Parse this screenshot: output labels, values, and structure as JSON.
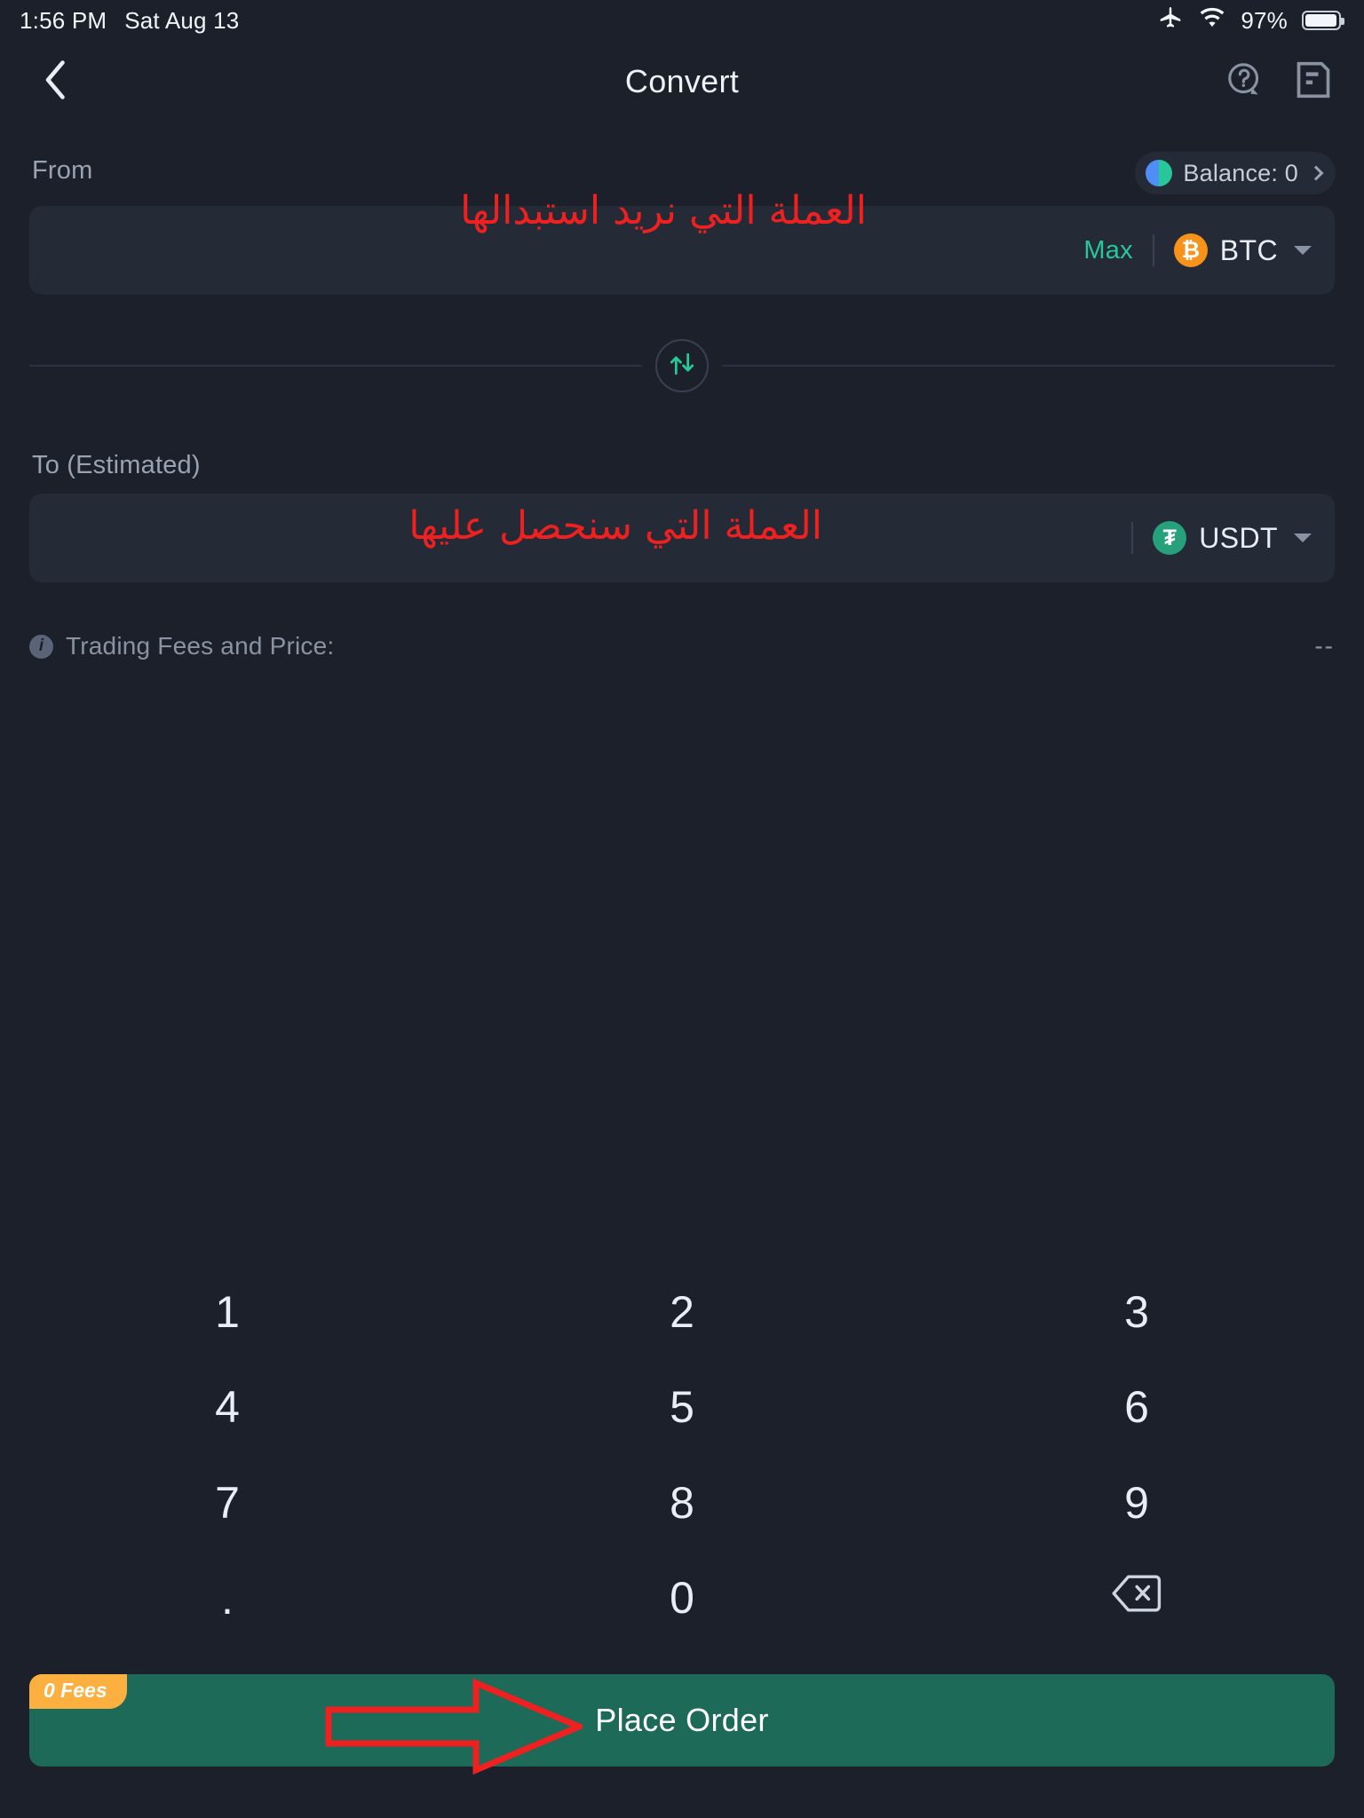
{
  "status_bar": {
    "time": "1:56 PM",
    "date": "Sat Aug 13",
    "battery_percent": "97%",
    "icons": [
      "airplane-icon",
      "wifi-icon",
      "battery-icon"
    ]
  },
  "header": {
    "title": "Convert",
    "back_icon": "chevron-left-icon",
    "help_icon": "help-circle-icon",
    "orders_icon": "order-history-icon"
  },
  "from_section": {
    "label": "From",
    "balance_label": "Balance: 0",
    "amount_value": "",
    "amount_placeholder": "",
    "max_label": "Max",
    "coin_symbol": "BTC",
    "coin_glyph": "₿",
    "coin_color": "#f7931a",
    "annotation": "العملة التي نريد استبدالها"
  },
  "swap": {
    "icon": "swap-vertical-icon",
    "color": "#27c79a"
  },
  "to_section": {
    "label": "To (Estimated)",
    "amount_value": "",
    "amount_placeholder": "",
    "coin_symbol": "USDT",
    "coin_glyph": "₮",
    "coin_color": "#26a17b",
    "annotation": "العملة التي سنحصل عليها"
  },
  "fees_row": {
    "info_icon": "info-icon",
    "label": "Trading Fees and Price:",
    "value": "--"
  },
  "keypad": {
    "keys": [
      "1",
      "2",
      "3",
      "4",
      "5",
      "6",
      "7",
      "8",
      "9",
      ".",
      "0",
      "backspace-icon"
    ],
    "backspace_icon": "backspace-icon"
  },
  "order_bar": {
    "badge": "0 Fees",
    "button_label": "Place Order",
    "button_color": "#1e6a59",
    "badge_color": "#fbb040"
  },
  "annotation_arrow": {
    "name": "red-arrow-annotation",
    "color": "#ef2020",
    "points_to": "Place Order"
  },
  "colors": {
    "page_background": "#1b202a",
    "field_background": "#242a36",
    "accent_green": "#27c79a",
    "annotation_red": "#ef2020"
  }
}
